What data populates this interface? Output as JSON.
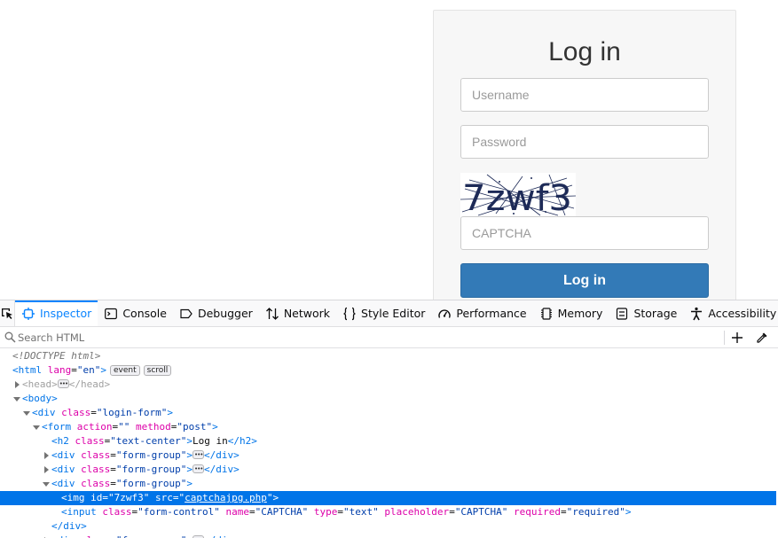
{
  "login_page": {
    "title": "Log in",
    "username_placeholder": "Username",
    "password_placeholder": "Password",
    "captcha_text": "7zwf3",
    "captcha_placeholder": "CAPTCHA",
    "submit_label": "Log in",
    "accent_color": "#337ab7"
  },
  "devtools": {
    "tabs": [
      {
        "label": "Inspector",
        "icon": "inspector-icon",
        "active": true
      },
      {
        "label": "Console",
        "icon": "console-icon"
      },
      {
        "label": "Debugger",
        "icon": "debugger-icon"
      },
      {
        "label": "Network",
        "icon": "network-icon"
      },
      {
        "label": "Style Editor",
        "icon": "style-editor-icon"
      },
      {
        "label": "Performance",
        "icon": "performance-icon"
      },
      {
        "label": "Memory",
        "icon": "memory-icon"
      },
      {
        "label": "Storage",
        "icon": "storage-icon"
      },
      {
        "label": "Accessibility",
        "icon": "accessibility-icon"
      }
    ],
    "search_placeholder": "Search HTML",
    "tree": {
      "doctype": "<!DOCTYPE html>",
      "html_tag": "html",
      "html_lang_attr": "lang",
      "html_lang_val": "\"en\"",
      "badge_event": "event",
      "badge_scroll": "scroll",
      "head_tag": "head",
      "body_tag": "body",
      "div_tag": "div",
      "class_attr": "class",
      "login_form_val": "\"login-form\"",
      "form_tag": "form",
      "action_attr": "action",
      "action_val": "\"\"",
      "method_attr": "method",
      "method_val": "\"post\"",
      "h2_tag": "h2",
      "text_center_val": "\"text-center\"",
      "h2_text": "Log in",
      "form_group_val": "\"form-group\"",
      "img_tag": "img",
      "id_attr": "id",
      "img_id_val": "\"7zwf3\"",
      "src_attr": "src",
      "img_src_val": "captchajpg.php",
      "input_tag": "input",
      "form_control_val": "\"form-control\"",
      "name_attr": "name",
      "name_val": "\"CAPTCHA\"",
      "type_attr": "type",
      "type_val": "\"text\"",
      "placeholder_attr": "placeholder",
      "placeholder_val": "\"CAPTCHA\"",
      "required_attr": "required",
      "required_val": "\"required\""
    }
  }
}
